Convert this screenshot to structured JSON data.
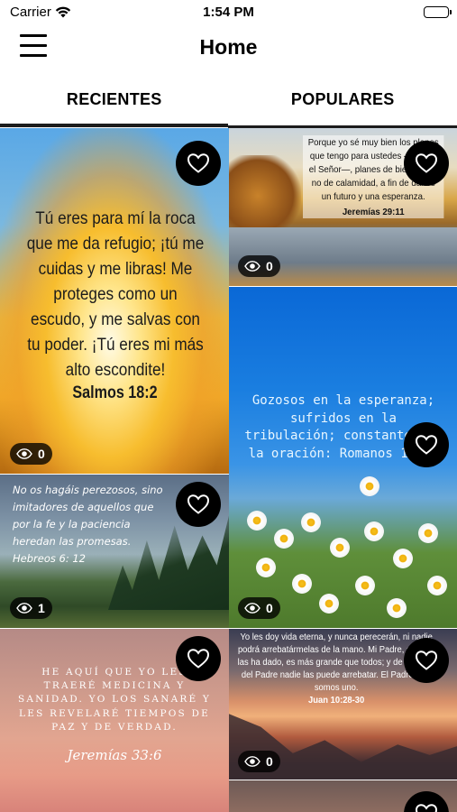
{
  "status_bar": {
    "carrier": "Carrier",
    "time": "1:54 PM",
    "battery_level": 1.0
  },
  "nav": {
    "title": "Home",
    "menu_icon": "hamburger-menu-icon"
  },
  "tabs": [
    {
      "label": "RECIENTES",
      "selected": true
    },
    {
      "label": "POPULARES",
      "selected": false
    }
  ],
  "cards": [
    {
      "id": "salmos-18-2",
      "text": "Tú eres para mí la roca que me da refugio; ¡tú me cuidas y me libras! Me proteges como un escudo, y me salvas con tu poder. ¡Tú eres mi más alto escondite!",
      "reference": "Salmos 18:2",
      "views": "0",
      "favorite_icon": "heart-outline-icon"
    },
    {
      "id": "hebreos-6-12",
      "text": "No os hagáis perezosos, sino imitadores de aquellos que por la fe y la paciencia heredan las promesas. Hebreos 6: 12",
      "views": "1",
      "favorite_icon": "heart-outline-icon"
    },
    {
      "id": "jeremias-33-6",
      "text": "HE AQUÍ QUE YO LES TRAERÉ MEDICINA Y SANIDAD. YO LOS SANARÉ Y LES REVELARÉ TIEMPOS DE PAZ Y DE VERDAD.",
      "reference": "Jeremías 33:6",
      "favorite_icon": "heart-outline-icon"
    },
    {
      "id": "jeremias-29-11",
      "text": "Porque yo sé muy bien los planes que tengo para ustedes —afirma el Señor—, planes de bienestar y no de calamidad, a fin de darles un futuro y una esperanza.",
      "reference": "Jeremías 29:11",
      "views": "0",
      "favorite_icon": "heart-outline-icon"
    },
    {
      "id": "romanos-12-12",
      "text": "Gozosos en la esperanza; sufridos en la tribulación; constantes en la oración: Romanos 12:12",
      "views": "0",
      "favorite_icon": "heart-outline-icon"
    },
    {
      "id": "juan-10-28-30",
      "text": "Yo les doy vida eterna, y nunca perecerán, ni nadie podrá arrebatármelas de la mano. Mi Padre, que me las ha dado, es más grande que todos; y de la mano del Padre nadie las puede arrebatar. El Padre y yo somos uno.",
      "reference": "Juan 10:28-30",
      "views": "0",
      "favorite_icon": "heart-outline-icon"
    },
    {
      "id": "partial-card",
      "favorite_icon": "heart-outline-icon"
    }
  ],
  "colors": {
    "tab_indicator": "#1c1c1c",
    "heart_button_bg": "#000000",
    "views_badge_bg": "#000000"
  }
}
